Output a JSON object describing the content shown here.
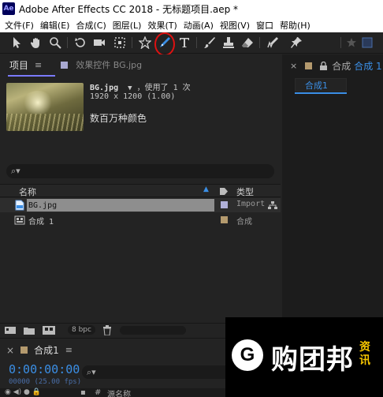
{
  "window": {
    "app_icon_text": "Ae",
    "title": "Adobe After Effects CC 2018 - 无标题项目.aep *"
  },
  "menu": {
    "items": [
      "文件(F)",
      "编辑(E)",
      "合成(C)",
      "图层(L)",
      "效果(T)",
      "动画(A)",
      "视图(V)",
      "窗口",
      "帮助(H)"
    ]
  },
  "toolbar": {
    "tools": [
      "selection-tool",
      "hand-tool",
      "zoom-tool",
      "rotation-tool",
      "camera-tool",
      "pan-behind-tool",
      "shape-tool",
      "pen-tool",
      "type-tool",
      "brush-tool",
      "clone-stamp-tool",
      "eraser-tool",
      "roto-brush-tool",
      "puppet-tool"
    ],
    "highlighted_tool": "pen-tool",
    "highlight_color": "#dd1111"
  },
  "project_panel": {
    "tab_label": "项目",
    "tab_menu": "≡",
    "effects_tab_label": "效果控件 BG.jpg",
    "preview": {
      "name": "BG.jpg",
      "dropdown": "▼",
      "used": "，使用了 1 次",
      "dimensions": "1920 x 1200 (1.00)",
      "colors": "数百万种颜色"
    },
    "search_icon_label": "⌕▾",
    "columns": {
      "name": "名称",
      "type": "类型"
    },
    "items": [
      {
        "name": "BG.jpg",
        "type": "Import",
        "label_color": "#b0b0d8",
        "selected": true
      },
      {
        "name": "合成 1",
        "type": "合成",
        "label_color": "#b49a6e",
        "selected": false
      }
    ],
    "bpc": "8 bpc"
  },
  "composition_panel": {
    "tab_label": "合成",
    "tab_link": "合成 1",
    "sub_tab": "合成1",
    "label_color": "#b49a6e"
  },
  "timeline": {
    "tab_label": "合成1",
    "tab_menu": "≡",
    "timecode": "0:00:00:00",
    "fps": "00000 (25.00 fps)",
    "search_icon_label": "⌕▾",
    "column_name": "源名称",
    "label_color": "#b49a6e"
  },
  "watermark": {
    "logo_letter": "G",
    "text": "购团邦",
    "side_text": "资讯"
  },
  "colors": {
    "accent_blue": "#3b8fe6",
    "panel_bg": "#232323"
  }
}
